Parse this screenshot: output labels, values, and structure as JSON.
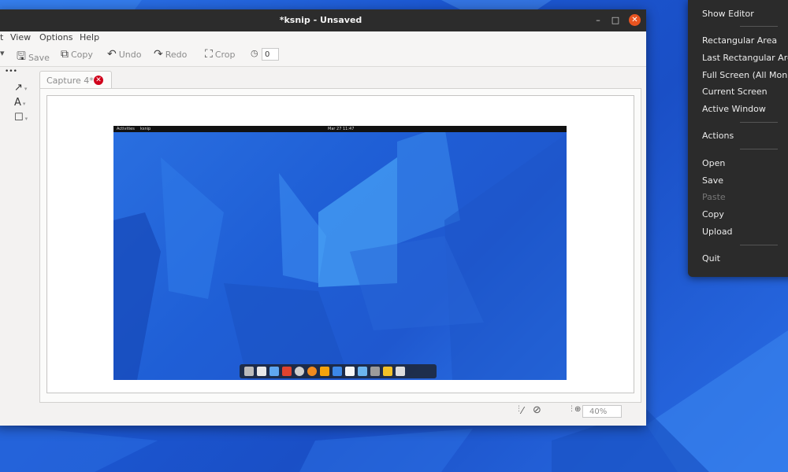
{
  "window": {
    "title": "*ksnip - Unsaved",
    "controls": {
      "minimize": "–",
      "maximize": "□",
      "close": "✕"
    }
  },
  "menubar": [
    "t",
    "View",
    "Options",
    "Help"
  ],
  "toolbar": {
    "save": "Save",
    "copy": "Copy",
    "undo": "Undo",
    "redo": "Redo",
    "crop": "Crop",
    "delay_value": "0"
  },
  "tab": {
    "label": "Capture 4*"
  },
  "status": {
    "zoom": "40%"
  },
  "screenshot_content": {
    "top_left": "Activities",
    "app": "ksnip",
    "clock": "Mar 27 11:47"
  },
  "tray_menu": {
    "items": [
      {
        "label": "Show Editor",
        "enabled": true
      },
      {
        "label": "Rectangular Area",
        "enabled": true
      },
      {
        "label": "Last Rectangular Area",
        "enabled": true
      },
      {
        "label": "Full Screen (All Monitors)",
        "enabled": true
      },
      {
        "label": "Current Screen",
        "enabled": true
      },
      {
        "label": "Active Window",
        "enabled": true
      },
      {
        "label": "Actions",
        "enabled": true
      },
      {
        "label": "Open",
        "enabled": true
      },
      {
        "label": "Save",
        "enabled": true
      },
      {
        "label": "Paste",
        "enabled": false
      },
      {
        "label": "Copy",
        "enabled": true
      },
      {
        "label": "Upload",
        "enabled": true
      },
      {
        "label": "Quit",
        "enabled": true
      }
    ]
  },
  "colors": {
    "titlebar": "#2c2c2c",
    "close_button": "#e95420",
    "tab_close": "#d0021b",
    "wallpaper": "#1e5fd8",
    "tray_bg": "#2b2b2b"
  }
}
